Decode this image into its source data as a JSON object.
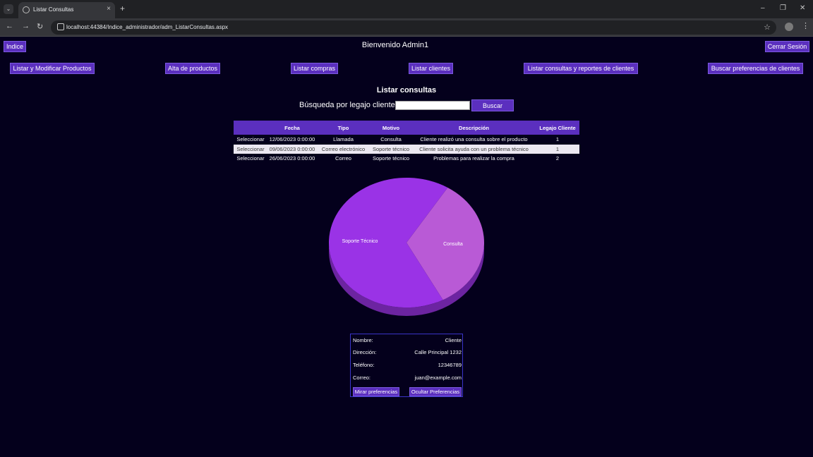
{
  "browser": {
    "tab_title": "Listar Consultas",
    "url": "localhost:44384/Indice_administrador/adm_ListarConsultas.aspx",
    "close_glyph": "×",
    "newtab_glyph": "+",
    "menu_glyph": "⌄",
    "back_glyph": "←",
    "forward_glyph": "→",
    "reload_glyph": "↻",
    "star_glyph": "☆",
    "minimize_glyph": "–",
    "restore_glyph": "❐",
    "window_close_glyph": "✕",
    "kebab_glyph": "⋮"
  },
  "header": {
    "indice_label": "Indice",
    "welcome": "Bienvenido Admin1",
    "logout_label": "Cerrar Sesión"
  },
  "nav": [
    {
      "label": "Listar y Modificar Productos"
    },
    {
      "label": "Alta de productos"
    },
    {
      "label": "Listar compras"
    },
    {
      "label": "Listar clientes"
    },
    {
      "label": "Listar consultas y reportes de clientes"
    },
    {
      "label": "Buscar preferencias de clientes"
    }
  ],
  "main": {
    "title": "Listar consultas",
    "search_label": "Búsqueda por legajo cliente",
    "search_value": "",
    "search_button": "Buscar"
  },
  "table": {
    "headers": [
      "",
      "Fecha",
      "Tipo",
      "Motivo",
      "Descripción",
      "Legajo Cliente"
    ],
    "rows": [
      {
        "select": "Seleccionar",
        "fecha": "12/06/2023 0:00:00",
        "tipo": "Llamada",
        "motivo": "Consulta",
        "descripcion": "Cliente realizó una consulta sobre el producto",
        "legajo": "1"
      },
      {
        "select": "Seleccionar",
        "fecha": "09/06/2023 0:00:00",
        "tipo": "Correo electrónico",
        "motivo": "Soporte técnico",
        "descripcion": "Cliente solicita ayuda con un problema técnico",
        "legajo": "1"
      },
      {
        "select": "Seleccionar",
        "fecha": "26/06/2023 0:00:00",
        "tipo": "Correo",
        "motivo": "Soporte técnico",
        "descripcion": "Problemas para realizar la compra",
        "legajo": "2"
      }
    ]
  },
  "chart_data": {
    "type": "pie",
    "title": "",
    "slices": [
      {
        "label": "Consulta",
        "value": 1,
        "color": "#b95ad6"
      },
      {
        "label": "Soporte Técnico",
        "value": 2,
        "color": "#9a33e6"
      }
    ],
    "start_angle_deg": -58,
    "three_d": true
  },
  "details": {
    "nombre_label": "Nombre:",
    "nombre": "Cliente",
    "direccion_label": "Dirección:",
    "direccion": "Calle Principal 1232",
    "telefono_label": "Teléfono:",
    "telefono": "12346789",
    "correo_label": "Correo:",
    "correo": "juan@example.com",
    "ver_preferencias": "Mirar preferencias",
    "ocultar_preferencias": "Ocultar Preferencias"
  },
  "colors": {
    "page_bg": "#04001c",
    "accent": "#5b2fbf",
    "alt_row": "#ece8f2"
  }
}
